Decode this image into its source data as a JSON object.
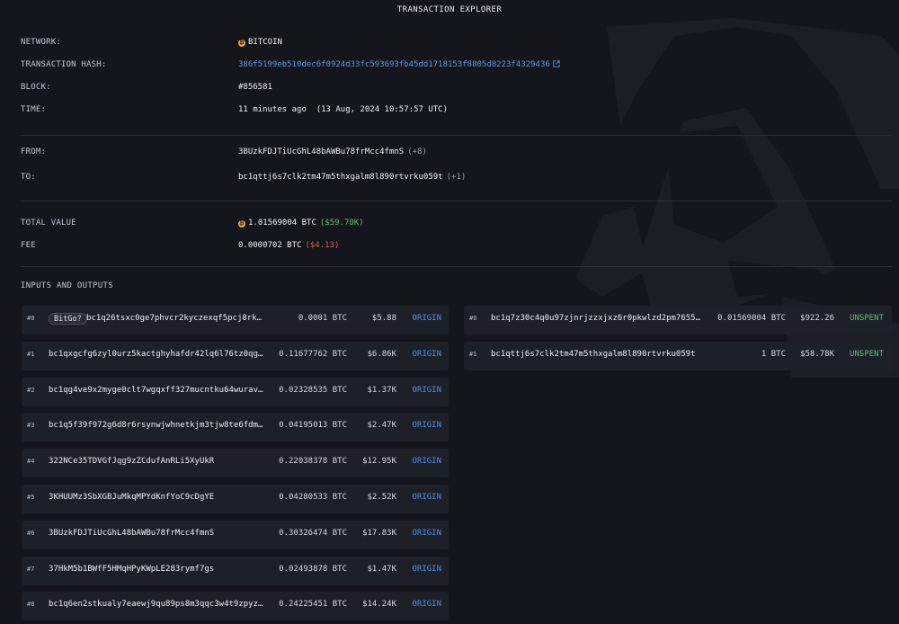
{
  "header": {
    "title": "TRANSACTION EXPLORER"
  },
  "details": {
    "network_label": "NETWORK:",
    "network_value": "BITCOIN",
    "hash_label": "TRANSACTION HASH:",
    "hash_value": "386f5199eb510dec6f0924d33fc593693fb45dd1718153f8805d8223f4329436",
    "block_label": "BLOCK:",
    "block_value": "#856581",
    "time_label": "TIME:",
    "time_value": "11 minutes ago  (13 Aug, 2024 10:57:57 UTC)",
    "from_label": "FROM:",
    "from_value": "3BUzkFDJTiUcGhL48bAWBu78frMcc4fmnS",
    "from_extra": "(+8)",
    "to_label": "TO:",
    "to_value": "bc1qttj6s7clk2tm47m5thxgalm8l890rtvrku059t",
    "to_extra": "(+1)",
    "total_label": "TOTAL VALUE",
    "total_value": "1.01569004 BTC",
    "total_usd": "($59.70K)",
    "fee_label": "FEE",
    "fee_value": "0.0000702 BTC",
    "fee_usd": "($4.13)"
  },
  "io": {
    "title": "INPUTS AND OUTPUTS",
    "inputs": [
      {
        "index": "#0",
        "tag": "BitGo?",
        "address": "bc1q26tsxc0ge7phvcr2kyczexqf5pcj8rk7…",
        "amount": "0.0001 BTC",
        "usd": "$5.88",
        "status": "ORIGIN"
      },
      {
        "index": "#1",
        "address": "bc1qxgcfg6zyl0urz5kactghyhafdr42lq6l76tz0qg4…",
        "amount": "0.11677762 BTC",
        "usd": "$6.86K",
        "status": "ORIGIN"
      },
      {
        "index": "#2",
        "address": "bc1qg4ve9x2myge0clt7wgqxff327mucntku64wuravq…",
        "amount": "0.02328535 BTC",
        "usd": "$1.37K",
        "status": "ORIGIN"
      },
      {
        "index": "#3",
        "address": "bc1q5f39f972g6d8r6rsynwjwhnetkjm3tjw8te6fdms…",
        "amount": "0.04195013 BTC",
        "usd": "$2.47K",
        "status": "ORIGIN"
      },
      {
        "index": "#4",
        "address": "322NCe35TDVGfJqg9zZCdufAnRLi5XyUkR",
        "amount": "0.22038378 BTC",
        "usd": "$12.95K",
        "status": "ORIGIN"
      },
      {
        "index": "#5",
        "address": "3KHUUMz3SbXGBJuMkqMPYdKnfYoC9cDgYE",
        "amount": "0.04280533 BTC",
        "usd": "$2.52K",
        "status": "ORIGIN"
      },
      {
        "index": "#6",
        "address": "3BUzkFDJTiUcGhL48bAWBu78frMcc4fmnS",
        "amount": "0.30326474 BTC",
        "usd": "$17.83K",
        "status": "ORIGIN"
      },
      {
        "index": "#7",
        "address": "37HkM5b1BWfF5HMqHPyKWpLE283rymf7gs",
        "amount": "0.02493878 BTC",
        "usd": "$1.47K",
        "status": "ORIGIN"
      },
      {
        "index": "#8",
        "address": "bc1q6en2stkualy7eaewj9qu89ps8m3qqc3w4t9zpyzv…",
        "amount": "0.24225451 BTC",
        "usd": "$14.24K",
        "status": "ORIGIN"
      }
    ],
    "outputs": [
      {
        "index": "#0",
        "address": "bc1q7z30c4q0u97zjnrjzzxjxz6r0pkwlzd2pm76553…",
        "amount": "0.01569004 BTC",
        "usd": "$922.26",
        "status": "UNSPENT"
      },
      {
        "index": "#1",
        "address": "bc1qttj6s7clk2tm47m5thxgalm8l890rtvrku059t",
        "amount": "1 BTC",
        "usd": "$58.78K",
        "status": "UNSPENT"
      }
    ]
  },
  "icons": {
    "currency": "bitcoin-icon",
    "external": "external-link-icon",
    "background": "arkham-logo-icon"
  },
  "colors": {
    "background": "#14161c",
    "row": "#1d2027",
    "link": "#5b97e8",
    "positive": "#5fbf73",
    "negative": "#e2574c",
    "bitcoin": "#f2a43a"
  }
}
